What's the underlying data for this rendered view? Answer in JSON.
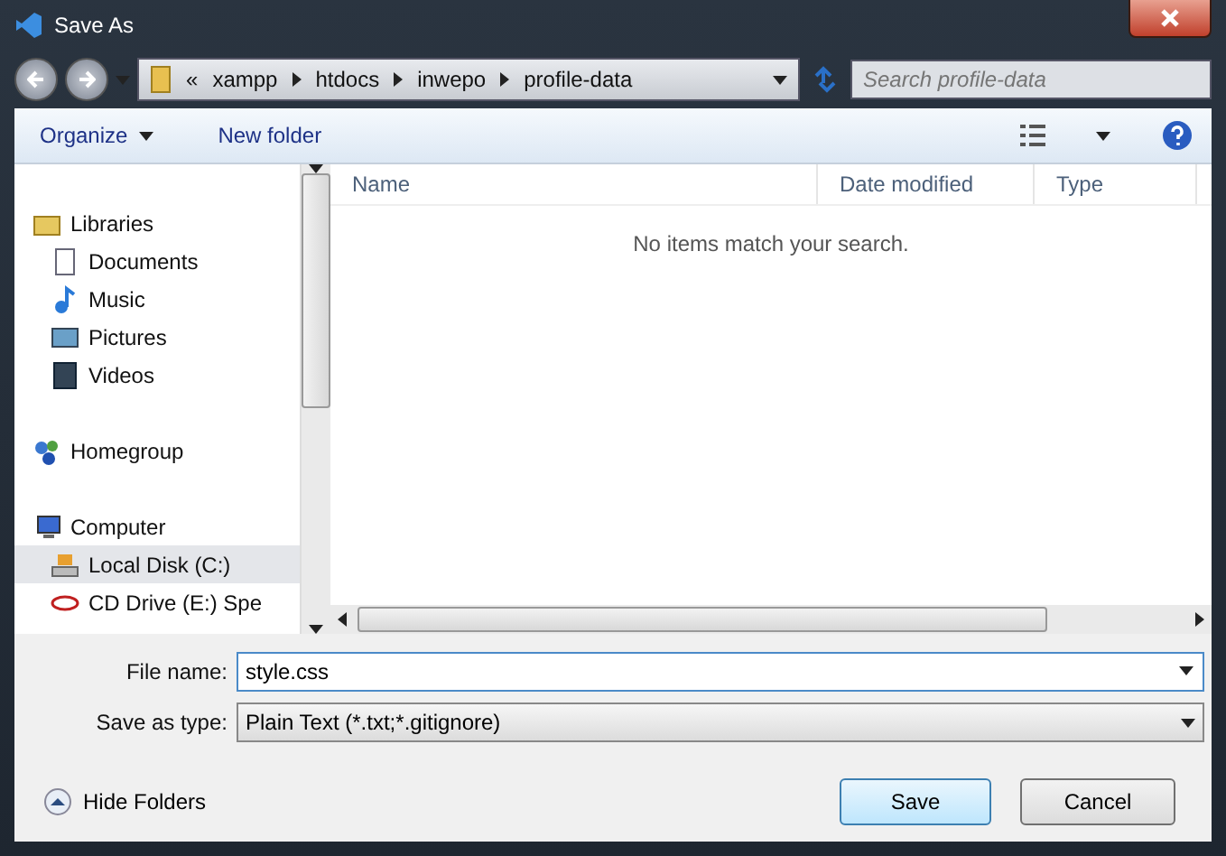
{
  "window": {
    "title": "Save As"
  },
  "address": {
    "overflow": "«",
    "crumbs": [
      "xampp",
      "htdocs",
      "inwepo",
      "profile-data"
    ]
  },
  "search": {
    "placeholder": "Search profile-data"
  },
  "toolbar": {
    "organize": "Organize",
    "new_folder": "New folder"
  },
  "sidebar": {
    "items": [
      {
        "label": "Libraries",
        "kind": "libraries",
        "selected": false,
        "children": [
          {
            "label": "Documents",
            "kind": "documents",
            "selected": false
          },
          {
            "label": "Music",
            "kind": "music",
            "selected": false
          },
          {
            "label": "Pictures",
            "kind": "pictures",
            "selected": false
          },
          {
            "label": "Videos",
            "kind": "videos",
            "selected": false
          }
        ]
      },
      {
        "label": "Homegroup",
        "kind": "homegroup",
        "selected": false
      },
      {
        "label": "Computer",
        "kind": "computer",
        "selected": false,
        "children": [
          {
            "label": "Local Disk (C:)",
            "kind": "disk",
            "selected": true
          },
          {
            "label": "CD Drive (E:) Spe",
            "kind": "cd",
            "selected": false
          }
        ]
      }
    ]
  },
  "file_list": {
    "columns": [
      "Name",
      "Date modified",
      "Type"
    ],
    "empty_message": "No items match your search."
  },
  "form": {
    "file_name_label": "File name:",
    "file_name": "style.css",
    "type_label": "Save as type:",
    "type_value": "Plain Text (*.txt;*.gitignore)"
  },
  "footer": {
    "hide_folders": "Hide Folders",
    "buttons": [
      "Save",
      "Cancel"
    ]
  }
}
